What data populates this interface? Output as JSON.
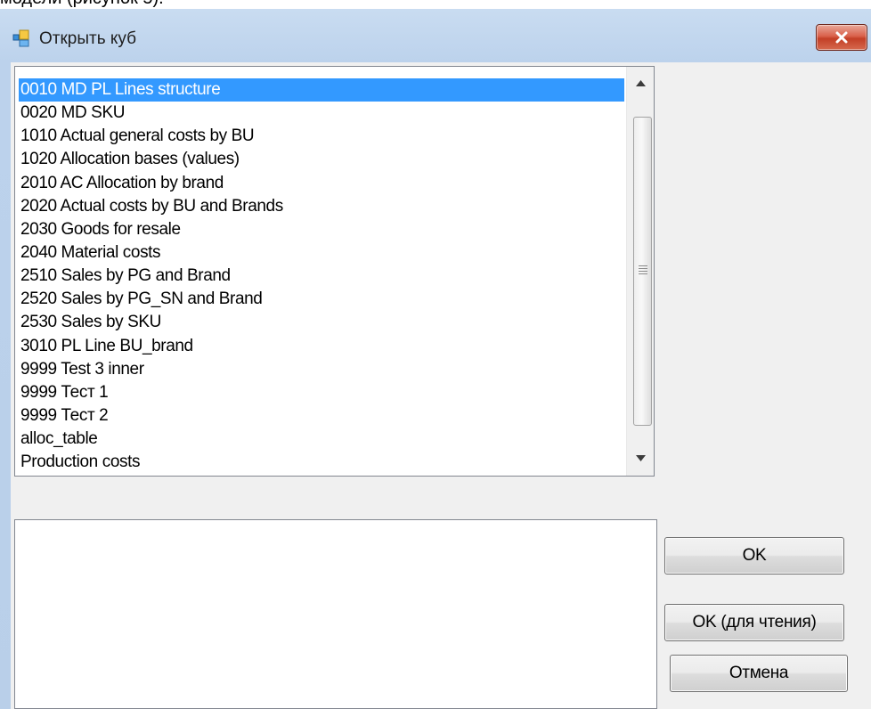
{
  "doc_fragment": "модели (рисунок 5).",
  "window": {
    "title": "Открыть куб"
  },
  "cube_list": {
    "items": [
      "0010 MD PL Lines structure",
      "0020 MD SKU",
      "1010 Actual general costs by BU",
      "1020 Allocation bases (values)",
      "2010 AC Allocation by brand",
      "2020 Actual costs by BU and Brands",
      "2030 Goods for resale",
      "2040 Material costs",
      "2510 Sales by PG and Brand",
      "2520 Sales by PG_SN and Brand",
      "2530 Sales by SKU",
      "3010 PL Line BU_brand",
      "9999 Test 3 inner",
      "9999 Тест 1",
      "9999 Тест 2",
      "alloc_table",
      "Production costs"
    ],
    "selected_index": 0
  },
  "description": "",
  "buttons": {
    "ok": "OK",
    "ok_readonly": "OK (для чтения)",
    "cancel": "Отмена"
  },
  "colors": {
    "selection": "#3399ff",
    "close_button": "#c9462e",
    "titlebar": "#c9dcf1"
  },
  "icons": {
    "app": "cube-window-icon",
    "close": "close-x-icon",
    "scroll_up": "scroll-up-arrow-icon",
    "scroll_down": "scroll-down-arrow-icon"
  }
}
